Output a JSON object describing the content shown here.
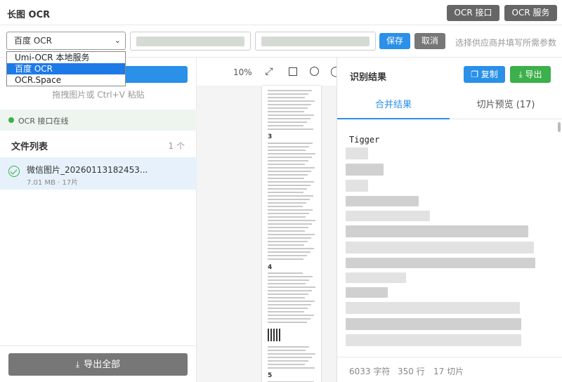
{
  "header": {
    "title": "长图 OCR",
    "api_button": "OCR 接口",
    "service_button": "OCR 服务"
  },
  "toolbar": {
    "provider_selected": "百度 OCR",
    "save_label": "保存",
    "cancel_label": "取消",
    "hint": "选择供应商并填写所需参数"
  },
  "provider_options": [
    {
      "label": "Umi-OCR 本地服务",
      "selected": false
    },
    {
      "label": "百度 OCR",
      "selected": true
    },
    {
      "label": "OCR.Space",
      "selected": false
    }
  ],
  "left": {
    "upload_hint": "拖拽图片或 Ctrl+V 粘贴",
    "status": "OCR 接口在线",
    "status_color": "#3cb04a",
    "file_list_title": "文件列表",
    "file_count": "1 个",
    "files": [
      {
        "name": "微信图片_20260113182453...",
        "meta": "7.01 MB · 17片"
      }
    ],
    "export_all": "导出全部"
  },
  "middle": {
    "zoom": "10%",
    "section_numbers": [
      "3",
      "4",
      "5"
    ]
  },
  "right": {
    "title": "识别结果",
    "copy_label": "复制",
    "export_label": "导出",
    "tabs": [
      "合并结果",
      "切片预览 (17)"
    ],
    "result_first_line": "Tigger",
    "stats": {
      "chars": "6033 字符",
      "lines": "350 行",
      "slices": "17 切片"
    }
  },
  "colors": {
    "primary": "#2a90e8",
    "success": "#3cb04a",
    "neutral": "#777777"
  }
}
